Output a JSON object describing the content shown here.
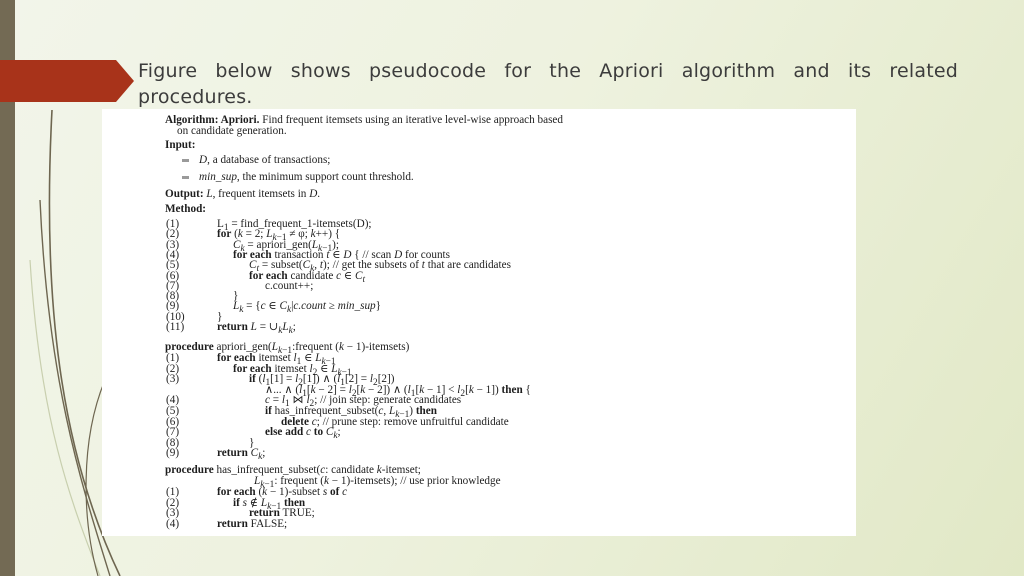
{
  "slide": {
    "heading": "Figure below shows pseudocode for the Apriori algorithm and its related procedures.",
    "colors": {
      "accent_arrow": "#a8331a",
      "left_bar": "#736a54",
      "background": "#eef2df",
      "text": "#3c3c3c"
    }
  },
  "figure": {
    "title_bold": "Algorithm: Apriori.",
    "title_rest": " Find frequent itemsets using an iterative level-wise approach based",
    "title_cont": "on candidate generation.",
    "input_label": "Input:",
    "inputs": [
      {
        "var": "D",
        "text": ", a database of transactions;"
      },
      {
        "var": "min_sup",
        "text": ", the minimum support count threshold."
      }
    ],
    "output_label": "Output:",
    "output_var": "L",
    "output_text": ", frequent itemsets in ",
    "output_var2": "D",
    "output_end": ".",
    "method_label": "Method:",
    "main_lines": [
      {
        "n": "(1)",
        "indent": 0,
        "html": "L<sub>1</sub> = find_frequent_1-itemsets(D);"
      },
      {
        "n": "(2)",
        "indent": 0,
        "html": "<b>for</b> (<i>k</i> = 2; <i>L</i><sub><i>k</i>−1</sub> ≠ φ; <i>k</i>++) {"
      },
      {
        "n": "(3)",
        "indent": 1,
        "html": "<i>C<sub>k</sub></i> = apriori_gen(<i>L</i><sub><i>k</i>−1</sub>);"
      },
      {
        "n": "(4)",
        "indent": 1,
        "html": "<b>for each</b> transaction <i>t</i> ∈ <i>D</i> { // scan <i>D</i> for counts"
      },
      {
        "n": "(5)",
        "indent": 2,
        "html": "<i>C<sub>t</sub></i> = subset(<i>C<sub>k</sub></i>, <i>t</i>); // get the subsets of <i>t</i> that are candidates"
      },
      {
        "n": "(6)",
        "indent": 2,
        "html": "<b>for each</b> candidate <i>c</i> ∈ <i>C<sub>t</sub></i>"
      },
      {
        "n": "(7)",
        "indent": 3,
        "html": "c.count++;"
      },
      {
        "n": "(8)",
        "indent": 1,
        "html": "}"
      },
      {
        "n": "(9)",
        "indent": 1,
        "html": "<i>L<sub>k</sub></i> = {<i>c</i> ∈ <i>C<sub>k</sub></i>|<i>c.count</i> ≥ <i>min_sup</i>}"
      },
      {
        "n": "(10)",
        "indent": 0,
        "html": "}"
      },
      {
        "n": "(11)",
        "indent": 0,
        "html": "<b>return</b> <i>L</i> = ∪<sub><i>k</i></sub><i>L<sub>k</sub></i>;"
      }
    ],
    "proc1_header": "procedure apriori_gen(<i>L</i><sub><i>k</i>−1</sub>:frequent (<i>k</i> − 1)-itemsets)",
    "proc1_lines": [
      {
        "n": "(1)",
        "indent": 0,
        "html": "<b>for each</b> itemset <i>l</i><sub>1</sub> ∈ <i>L</i><sub><i>k</i>−1</sub>"
      },
      {
        "n": "(2)",
        "indent": 1,
        "html": "<b>for each</b> itemset <i>l</i><sub>2</sub> ∈ <i>L</i><sub><i>k</i>−1</sub>"
      },
      {
        "n": "(3)",
        "indent": 2,
        "html": "<b>if</b> (<i>l</i><sub>1</sub>[1] = <i>l</i><sub>2</sub>[1]) ∧ (<i>l</i><sub>1</sub>[2] = <i>l</i><sub>2</sub>[2])"
      },
      {
        "n": "",
        "indent": 3,
        "html": "∧... ∧ (<i>l</i><sub>1</sub>[<i>k</i> − 2] = <i>l</i><sub>2</sub>[<i>k</i> − 2]) ∧ (<i>l</i><sub>1</sub>[<i>k</i> − 1] &lt; <i>l</i><sub>2</sub>[<i>k</i> − 1]) <b>then</b> {"
      },
      {
        "n": "(4)",
        "indent": 3,
        "html": "<i>c</i> = <i>l</i><sub>1</sub> ⋈ <i>l</i><sub>2</sub>; // join step: generate candidates"
      },
      {
        "n": "(5)",
        "indent": 3,
        "html": "<b>if</b> has_infrequent_subset(<i>c</i>, <i>L</i><sub><i>k</i>−1</sub>) <b>then</b>"
      },
      {
        "n": "(6)",
        "indent": 4,
        "html": "<b>delete</b> <i>c</i>; // prune step: remove unfruitful candidate"
      },
      {
        "n": "(7)",
        "indent": 3,
        "html": "<b>else add</b> <i>c</i> <b>to</b> <i>C<sub>k</sub></i>;"
      },
      {
        "n": "(8)",
        "indent": 2,
        "html": "}"
      },
      {
        "n": "(9)",
        "indent": 0,
        "html": "<b>return</b> <i>C<sub>k</sub></i>;"
      }
    ],
    "proc2_header": "procedure has_infrequent_subset(<i>c</i>: candidate <i>k</i>-itemset;",
    "proc2_header_cont": "<i>L</i><sub><i>k</i>−1</sub>: frequent (<i>k</i> − 1)-itemsets); // use prior knowledge",
    "proc2_lines": [
      {
        "n": "(1)",
        "indent": 0,
        "html": "<b>for each</b> (<i>k</i> − 1)-subset <i>s</i> <b>of</b> <i>c</i>"
      },
      {
        "n": "(2)",
        "indent": 1,
        "html": "<b>if</b> <i>s</i> ∉ <i>L</i><sub><i>k</i>−1</sub> <b>then</b>"
      },
      {
        "n": "(3)",
        "indent": 2,
        "html": "<b>return</b> TRUE;"
      },
      {
        "n": "(4)",
        "indent": 0,
        "html": "<b>return</b> FALSE;"
      }
    ]
  }
}
